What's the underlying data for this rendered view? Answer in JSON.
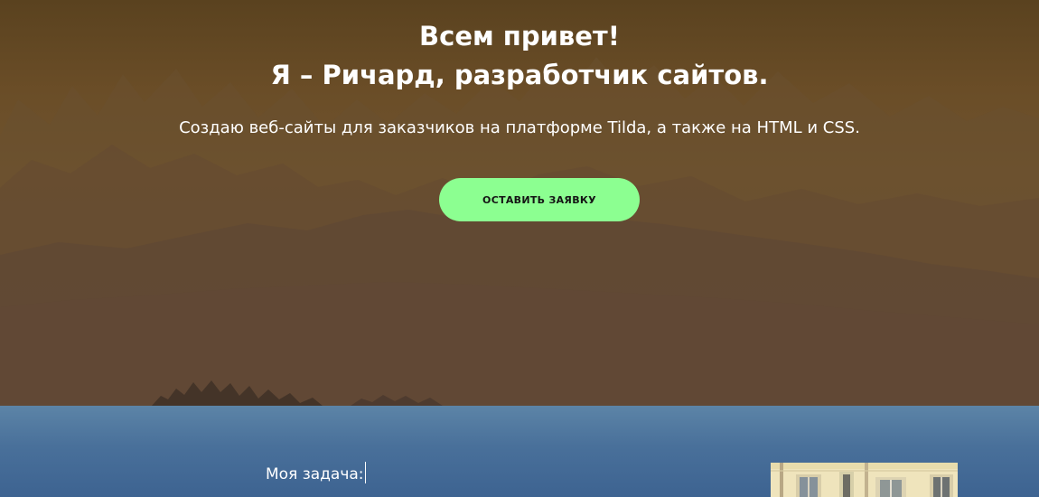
{
  "hero": {
    "title_line1": "Всем привет!",
    "title_line2": "Я – Ричард, разработчик сайтов.",
    "subtitle": "Создаю веб-сайты для заказчиков на платформе Tilda, а также на HTML и CSS.",
    "cta_label": "ОСТАВИТЬ ЗАЯВКУ",
    "colors": {
      "overlay": "#6a4f2d",
      "cta": "#8cff91",
      "cta_text": "#141414"
    }
  },
  "task_section": {
    "label": "Моя задача:",
    "background": "#4b729b"
  }
}
